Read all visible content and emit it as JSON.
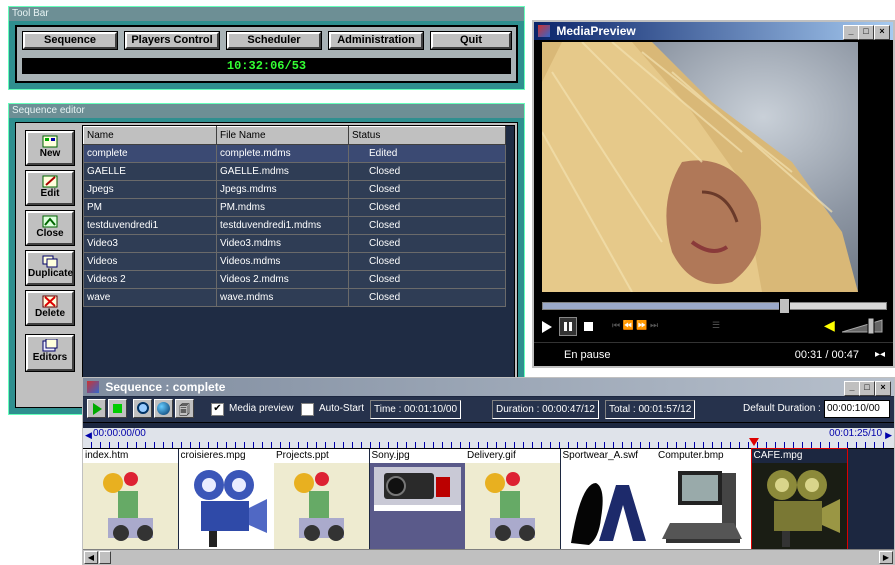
{
  "toolbar": {
    "title": "Tool Bar",
    "buttons": [
      "Sequence",
      "Players Control",
      "Scheduler",
      "Administration",
      "Quit"
    ],
    "clock": "10:32:06/53"
  },
  "editor": {
    "title": "Sequence editor",
    "side_buttons": [
      "New",
      "Edit",
      "Close",
      "Duplicate",
      "Delete",
      "Editors"
    ],
    "columns": [
      "Name",
      "File Name",
      "Status"
    ],
    "rows": [
      [
        "complete",
        "complete.mdms",
        "Edited"
      ],
      [
        "GAELLE",
        "GAELLE.mdms",
        "Closed"
      ],
      [
        "Jpegs",
        "Jpegs.mdms",
        "Closed"
      ],
      [
        "PM",
        "PM.mdms",
        "Closed"
      ],
      [
        "testduvendredi1",
        "testduvendredi1.mdms",
        "Closed"
      ],
      [
        "Video3",
        "Video3.mdms",
        "Closed"
      ],
      [
        "Videos",
        "Videos.mdms",
        "Closed"
      ],
      [
        "Videos 2",
        "Videos 2.mdms",
        "Closed"
      ],
      [
        "wave",
        "wave.mdms",
        "Closed"
      ]
    ]
  },
  "preview": {
    "title": "MediaPreview",
    "status": "En pause",
    "time": "00:31 / 00:47",
    "progress": 0.7
  },
  "sequence": {
    "title": "Sequence : complete",
    "media_preview_label": "Media preview",
    "auto_start_label": "Auto-Start",
    "media_preview_checked": true,
    "auto_start_checked": false,
    "time": "Time : 00:01:10/00",
    "duration": "Duration : 00:00:47/12",
    "total": "Total : 00:01:57/12",
    "default_duration_label": "Default Duration :",
    "default_duration_value": "00:00:10/00",
    "timeline_start": "00:00:00/00",
    "timeline_end": "00:01:25/10",
    "items": [
      "index.htm",
      "croisieres.mpg",
      "Projects.ppt",
      "Sony.jpg",
      "Delivery.gif",
      "Sportwear_A.swf",
      "Computer.bmp",
      "CAFE.mpg"
    ]
  }
}
